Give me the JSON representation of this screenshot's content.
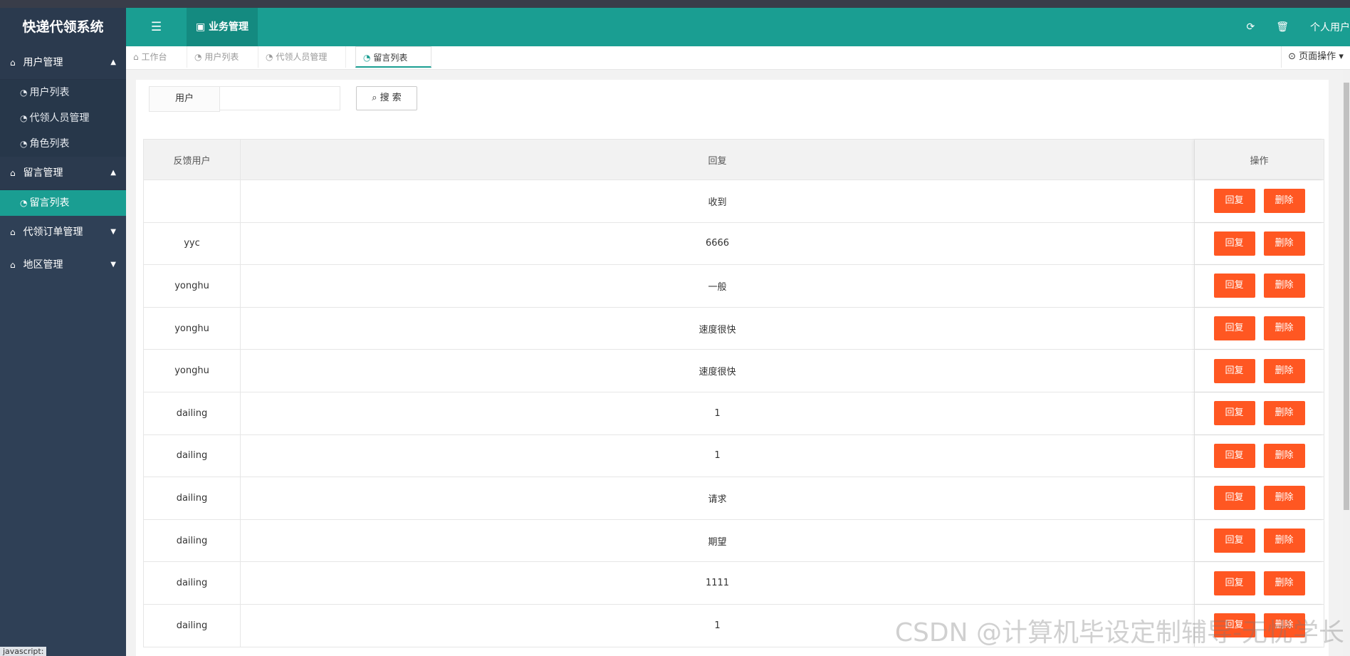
{
  "app": {
    "title": "快递代领系统"
  },
  "sidebar": {
    "groups": [
      {
        "label": "用户管理",
        "expanded": true,
        "items": [
          {
            "label": "用户列表"
          },
          {
            "label": "代领人员管理"
          },
          {
            "label": "角色列表"
          }
        ]
      },
      {
        "label": "留言管理",
        "expanded": true,
        "items": [
          {
            "label": "留言列表",
            "active": true
          }
        ]
      },
      {
        "label": "代领订单管理",
        "expanded": false,
        "items": []
      },
      {
        "label": "地区管理",
        "expanded": false,
        "items": []
      }
    ]
  },
  "header": {
    "menu_icon": "list-icon",
    "business_label": "业务管理",
    "refresh_icon": "refresh-icon",
    "trash_icon": "trash-icon",
    "user_label": "个人用户"
  },
  "tabs": [
    {
      "label": "工作台",
      "closable": false
    },
    {
      "label": "用户列表",
      "closable": true
    },
    {
      "label": "代领人员管理",
      "closable": true
    },
    {
      "label": "留言列表",
      "closable": true,
      "active": true
    }
  ],
  "page_ops_label": "页面操作",
  "search": {
    "label": "用户",
    "value": "",
    "button_label": "搜 索"
  },
  "table": {
    "headers": [
      "反馈用户",
      "回复",
      "操作"
    ],
    "rows": [
      {
        "user": "",
        "reply": "收到"
      },
      {
        "user": "yyc",
        "reply": "6666"
      },
      {
        "user": "yonghu",
        "reply": "一般"
      },
      {
        "user": "yonghu",
        "reply": "速度很快"
      },
      {
        "user": "yonghu",
        "reply": "速度很快"
      },
      {
        "user": "dailing",
        "reply": "1"
      },
      {
        "user": "dailing",
        "reply": "1"
      },
      {
        "user": "dailing",
        "reply": "请求"
      },
      {
        "user": "dailing",
        "reply": "期望"
      },
      {
        "user": "dailing",
        "reply": "1111"
      },
      {
        "user": "dailing",
        "reply": "1"
      }
    ],
    "reply_btn": "回复",
    "delete_btn": "删除"
  },
  "watermark": "CSDN @计算机毕设定制辅导-无忧学长",
  "status_tip": "javascript:",
  "colors": {
    "accent": "#1a9e92",
    "sidebar": "#2f4056",
    "danger": "#ff5722"
  }
}
